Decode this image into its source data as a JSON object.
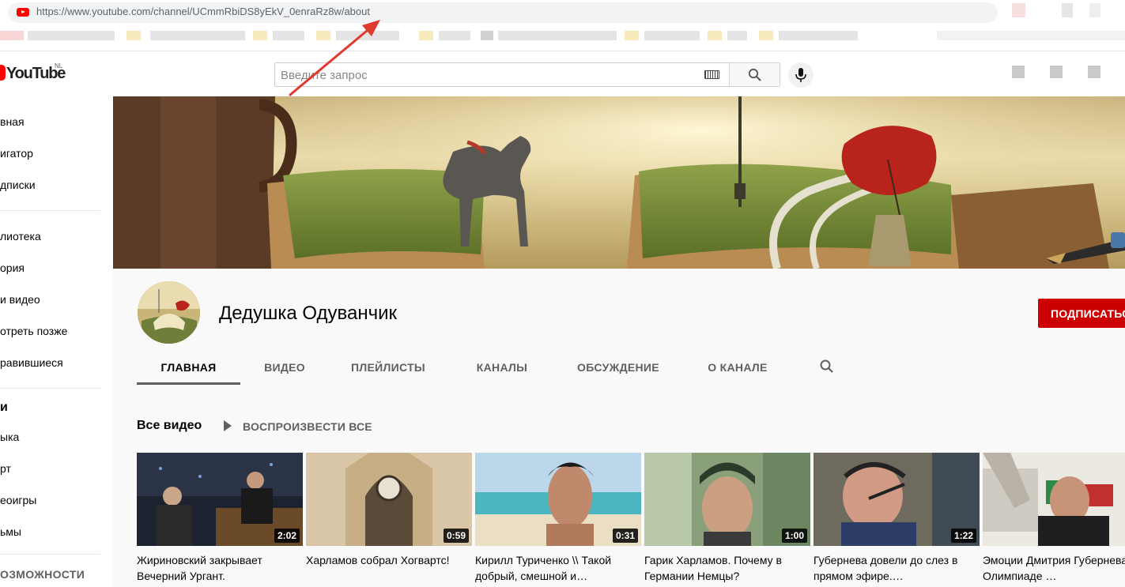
{
  "browser": {
    "url": "https://www.youtube.com/channel/UCmmRbiDS8yEkV_0enraRz8w/about"
  },
  "masthead": {
    "logo_text": "YouTube",
    "country_code": "NL",
    "search_placeholder": "Введите запрос"
  },
  "sidebar": {
    "items": [
      {
        "label": "вная"
      },
      {
        "label": "игатор"
      },
      {
        "label": "дписки"
      },
      {
        "label": "лиотека"
      },
      {
        "label": "ория"
      },
      {
        "label": "и видео"
      },
      {
        "label": "отреть позже"
      },
      {
        "label": "равившиеся"
      },
      {
        "label": "и"
      },
      {
        "label": "ыка"
      },
      {
        "label": "рт"
      },
      {
        "label": "еоигры"
      },
      {
        "label": "ьмы"
      },
      {
        "label": "ОЗМОЖНОСТИ"
      }
    ]
  },
  "channel": {
    "name": "Дедушка Одуванчик",
    "subscribe_label": "ПОДПИСАТЬСЯ",
    "tabs": [
      {
        "label": "ГЛАВНАЯ",
        "active": true
      },
      {
        "label": "ВИДЕО",
        "active": false
      },
      {
        "label": "ПЛЕЙЛИСТЫ",
        "active": false
      },
      {
        "label": "КАНАЛЫ",
        "active": false
      },
      {
        "label": "ОБСУЖДЕНИЕ",
        "active": false
      },
      {
        "label": "О КАНАЛЕ",
        "active": false
      }
    ]
  },
  "shelf": {
    "title": "Все видео",
    "play_all_label": "ВОСПРОИЗВЕСТИ ВСЕ",
    "videos": [
      {
        "title": "Жириновский закрывает Вечерний Ургант.",
        "duration": "2:02"
      },
      {
        "title": "Харламов собрал Хогвартс!",
        "duration": "0:59"
      },
      {
        "title": "Кирилл Туриченко \\\\ Такой добрый, смешной и…",
        "duration": "0:31"
      },
      {
        "title": "Гарик Харламов. Почему в Германии Немцы?",
        "duration": "1:00"
      },
      {
        "title": "Губернева довели до слез в прямом эфире.…",
        "duration": "1:22"
      },
      {
        "title": "Эмоции Дмитрия Губернева на Олимпиаде …",
        "duration": ""
      }
    ]
  },
  "colors": {
    "youtube_red": "#ff0000",
    "subscribe_red": "#cc0000",
    "annotation_arrow": "#e03a2f"
  }
}
